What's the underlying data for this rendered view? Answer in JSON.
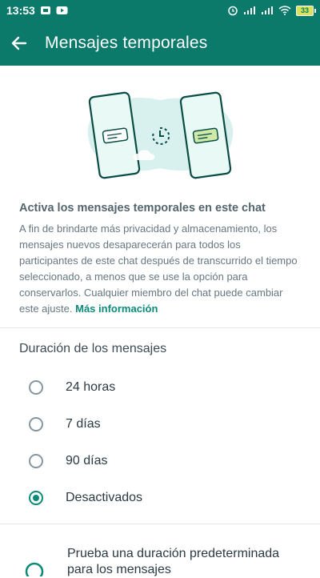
{
  "status_bar": {
    "time": "13:53",
    "battery": "33",
    "icons": [
      "notification-app-icon",
      "youtube-icon",
      "alarm-icon",
      "signal-icon",
      "signal-icon",
      "wifi-icon",
      "battery-icon"
    ]
  },
  "app_bar": {
    "back_icon": "arrow-left-icon",
    "title": "Mensajes temporales"
  },
  "colors": {
    "primary": "#0b7a6a",
    "accent": "#0b8a77",
    "link": "#0a8a7a"
  },
  "intro": {
    "title": "Activa los mensajes temporales en este chat",
    "body": "A fin de brindarte más privacidad y almacenamiento, los mensajes nuevos desaparecerán para todos los participantes de este chat después de transcurrido el tiempo seleccionado, a menos que se use la opción para conservarlos. Cualquier miembro del chat puede cambiar este ajuste.",
    "link": "Más información"
  },
  "duration": {
    "title": "Duración de los mensajes",
    "options": [
      {
        "label": "24 horas",
        "checked": false
      },
      {
        "label": "7 días",
        "checked": false
      },
      {
        "label": "90 días",
        "checked": false
      },
      {
        "label": "Desactivados",
        "checked": true
      }
    ]
  },
  "promo": {
    "text": "Prueba una duración predeterminada para los mensajes"
  }
}
